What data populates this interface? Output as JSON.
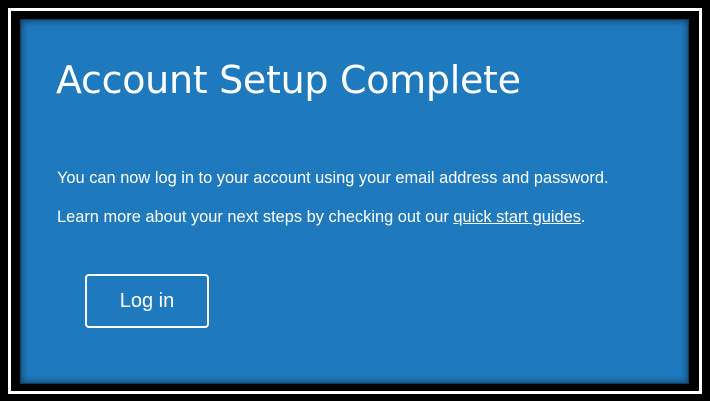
{
  "dialog": {
    "title": "Account Setup Complete",
    "message_line_1": "You can now log in to your account using your email address and password.",
    "message_line_2_prefix": "Learn more about your next steps by checking out our ",
    "message_line_2_link": "quick start guides",
    "message_line_2_suffix": ".",
    "login_button_label": "Log in"
  },
  "colors": {
    "card_background": "#1f79bd",
    "text": "#ffffff",
    "frame": "#000000"
  }
}
